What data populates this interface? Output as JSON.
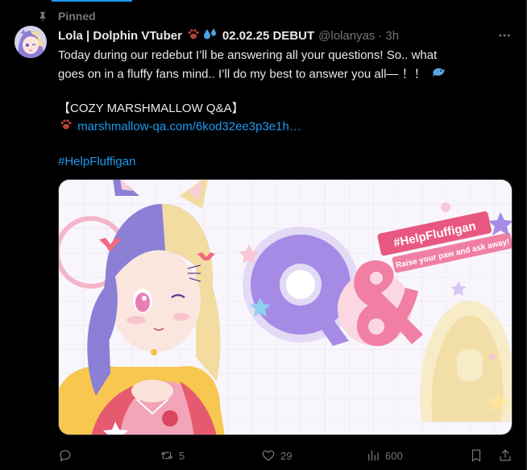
{
  "pinned_label": "Pinned",
  "author": {
    "name": "Lola | Dolphin VTuber",
    "debut": "02.02.25 DEBUT",
    "handle": "@lolanyas",
    "time": "3h",
    "separator": "·"
  },
  "tweet": {
    "line1": "Today during our redebut I’ll be answering all your questions! So.. what",
    "line2": "goes on in a fluffy fans mind.. I’ll do my best to answer you all— ！！",
    "heading": "【COZY MARSHMALLOW Q&A】",
    "link": "marshmallow-qa.com/6kod32ee3p3e1h…",
    "hashtag": "#HelpFluffigan"
  },
  "media": {
    "hashtag_banner": "#HelpFluffigan",
    "subbanner": "Raise your paw and ask away!",
    "qa_text": "Q&A",
    "colors": {
      "purple": "#a58be6",
      "pink": "#f07fa3",
      "cream": "#f2dfa8"
    }
  },
  "actions": {
    "reply_icon": "reply-icon",
    "retweet_count": "5",
    "like_count": "29",
    "view_count": "600",
    "bookmark_icon": "bookmark-icon",
    "share_icon": "share-icon"
  },
  "colors": {
    "accent": "#1d9bf0",
    "muted": "#71767b",
    "text": "#e7e9ea",
    "background": "#000000"
  }
}
